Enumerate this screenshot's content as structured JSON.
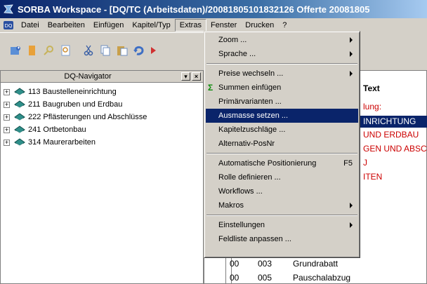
{
  "window": {
    "title": "SORBA Workspace - [DQ/TC (Arbeitsdaten)/20081805101832126 Offerte 20081805",
    "app_icon": "sorba-app-icon"
  },
  "menubar": {
    "items": [
      {
        "label": "Datei",
        "name": "menu-datei"
      },
      {
        "label": "Bearbeiten",
        "name": "menu-bearbeiten"
      },
      {
        "label": "Einfügen",
        "name": "menu-einfuegen"
      },
      {
        "label": "Kapitel/Typ",
        "name": "menu-kapitel-typ"
      },
      {
        "label": "Extras",
        "name": "menu-extras"
      },
      {
        "label": "Fenster",
        "name": "menu-fenster"
      },
      {
        "label": "Drucken",
        "name": "menu-drucken"
      },
      {
        "label": "?",
        "name": "menu-help"
      }
    ]
  },
  "navigator": {
    "title": "DQ-Navigator",
    "items": [
      {
        "label": "113 Baustelleneinrichtung"
      },
      {
        "label": "211 Baugruben und Erdbau"
      },
      {
        "label": "222 Pflästerungen und Abschlüsse"
      },
      {
        "label": "241 Ortbetonbau"
      },
      {
        "label": "314 Maurerarbeiten"
      }
    ]
  },
  "rightpane": {
    "column_header": "Text",
    "lines": [
      {
        "text": "lung:",
        "color": "#cc0000"
      },
      {
        "text": "INRICHTUNG",
        "color": "#ffffff"
      },
      {
        "text": "UND ERDBAU",
        "color": "#cc0000"
      },
      {
        "text": "GEN UND ABSC",
        "color": "#cc0000"
      },
      {
        "text": "J",
        "color": "#cc0000"
      },
      {
        "text": "ITEN",
        "color": "#cc0000"
      }
    ],
    "rows": [
      {
        "c1": "00",
        "c2": "003",
        "c3": "Grundrabatt"
      },
      {
        "c1": "00",
        "c2": "005",
        "c3": "Pauschalabzug"
      }
    ]
  },
  "extras_menu": {
    "items": [
      {
        "label": "Zoom ...",
        "submenu": true
      },
      {
        "label": "Sprache ...",
        "submenu": true
      },
      {
        "sep": true
      },
      {
        "label": "Preise wechseln ...",
        "submenu": true
      },
      {
        "label": "Summen einfügen",
        "icon": "sum-icon"
      },
      {
        "label": "Primärvarianten ..."
      },
      {
        "label": "Ausmasse setzen ...",
        "highlighted": true
      },
      {
        "label": "Kapitelzuschläge ..."
      },
      {
        "label": "Alternativ-PosNr"
      },
      {
        "sep": true
      },
      {
        "label": "Automatische Positionierung",
        "shortcut": "F5"
      },
      {
        "label": "Rolle definieren ..."
      },
      {
        "label": "Workflows ..."
      },
      {
        "label": "Makros",
        "submenu": true
      },
      {
        "sep": true
      },
      {
        "label": "Einstellungen",
        "submenu": true
      },
      {
        "label": "Feldliste anpassen ..."
      }
    ]
  },
  "colors": {
    "titlebar": "#0a246a",
    "highlight": "#0a246a",
    "text_red": "#cc0000"
  }
}
